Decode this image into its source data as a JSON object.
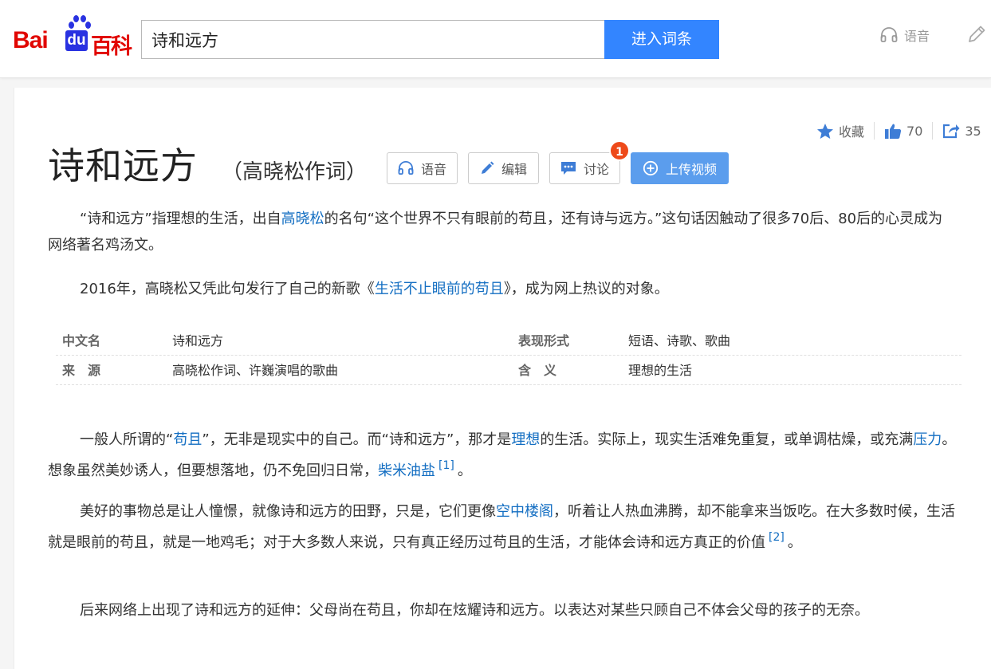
{
  "header": {
    "logo_bai": "Bai",
    "logo_du": "du",
    "logo_baike": "百科",
    "search_value": "诗和远方",
    "search_button": "进入词条",
    "voice_label": "语音"
  },
  "top_actions": {
    "favorite_label": "收藏",
    "like_count": "70",
    "share_count": "35"
  },
  "entry": {
    "title": "诗和远方",
    "subtitle": "（高晓松作词）"
  },
  "toolbar": {
    "voice_label": "语音",
    "edit_label": "编辑",
    "discuss_label": "讨论",
    "discuss_badge": "1",
    "upload_label": "上传视频"
  },
  "summary": {
    "p1_a": "“诗和远方”指理想的生活，出自",
    "p1_link": "高晓松",
    "p1_b": "的名句“这个世界不只有眼前的苟且，还有诗与远方。”这句话因触动了很多70后、80后的心灵成为网络著名鸡汤文。",
    "p2_a": "2016年，高晓松又凭此句发行了自己的新歌《",
    "p2_link": "生活不止眼前的苟且",
    "p2_b": "》，成为网上热议的对象。"
  },
  "basic_info": [
    {
      "k1": "中文名",
      "v1": "诗和远方",
      "k2": "表现形式",
      "v2": "短语、诗歌、歌曲"
    },
    {
      "k1": "来　源",
      "v1": "高晓松作词、许巍演唱的歌曲",
      "k2": "含　义",
      "v2": "理想的生活"
    }
  ],
  "body": {
    "p3_a": "一般人所谓的“",
    "p3_link1": "苟且",
    "p3_b": "”，无非是现实中的自己。而“诗和远方”，那才是",
    "p3_link2": "理想",
    "p3_c": "的生活。实际上，现实生活难免重复，或单调枯燥，或充满",
    "p3_link3": "压力",
    "p3_d": "。想象虽然美妙诱人，但要想落地，仍不免回归日常，",
    "p3_link4": "柴米油盐",
    "p3_ref": "[1]",
    "p3_e": "。",
    "p4_a": "美好的事物总是让人憧憬，就像诗和远方的田野，只是，它们更像",
    "p4_link": "空中楼阁",
    "p4_b": "，听着让人热血沸腾，却不能拿来当饭吃。在大多数时候，生活就是眼前的苟且，就是一地鸡毛；对于大多数人来说，只有真正经历过苟且的生活，才能体会诗和远方真正的价值",
    "p4_ref": "[2]",
    "p4_c": "。",
    "p5": "后来网络上出现了诗和远方的延伸：父母尚在苟且，你却在炫耀诗和远方。以表达对某些只顾自己不体会父母的孩子的无奈。"
  }
}
